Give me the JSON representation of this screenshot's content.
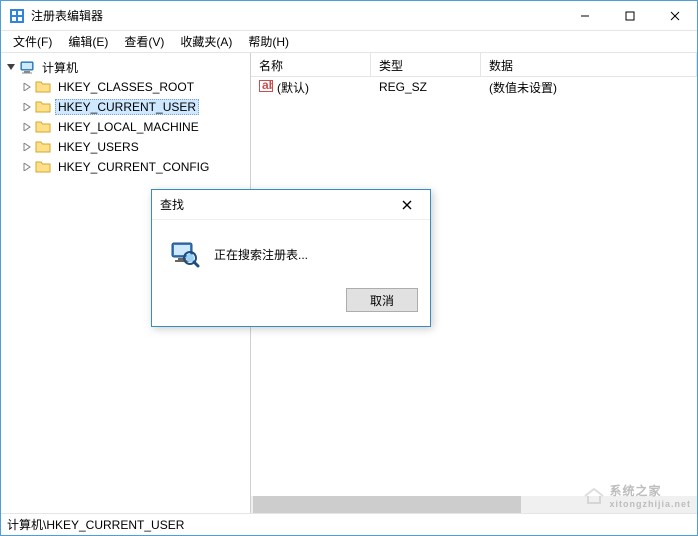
{
  "window": {
    "title": "注册表编辑器"
  },
  "menubar": {
    "items": [
      {
        "label": "文件(F)"
      },
      {
        "label": "编辑(E)"
      },
      {
        "label": "查看(V)"
      },
      {
        "label": "收藏夹(A)"
      },
      {
        "label": "帮助(H)"
      }
    ]
  },
  "tree": {
    "root": {
      "label": "计算机",
      "expanded": true
    },
    "keys": [
      {
        "label": "HKEY_CLASSES_ROOT",
        "selected": false
      },
      {
        "label": "HKEY_CURRENT_USER",
        "selected": true
      },
      {
        "label": "HKEY_LOCAL_MACHINE",
        "selected": false
      },
      {
        "label": "HKEY_USERS",
        "selected": false
      },
      {
        "label": "HKEY_CURRENT_CONFIG",
        "selected": false
      }
    ]
  },
  "list": {
    "columns": {
      "name": "名称",
      "type": "类型",
      "data": "数据"
    },
    "rows": [
      {
        "name": "(默认)",
        "type": "REG_SZ",
        "data": "(数值未设置)"
      }
    ]
  },
  "statusbar": {
    "path": "计算机\\HKEY_CURRENT_USER"
  },
  "dialog": {
    "title": "查找",
    "message": "正在搜索注册表...",
    "cancel": "取消"
  },
  "watermark": {
    "text": "系统之家",
    "url": "xitongzhijia.net"
  }
}
